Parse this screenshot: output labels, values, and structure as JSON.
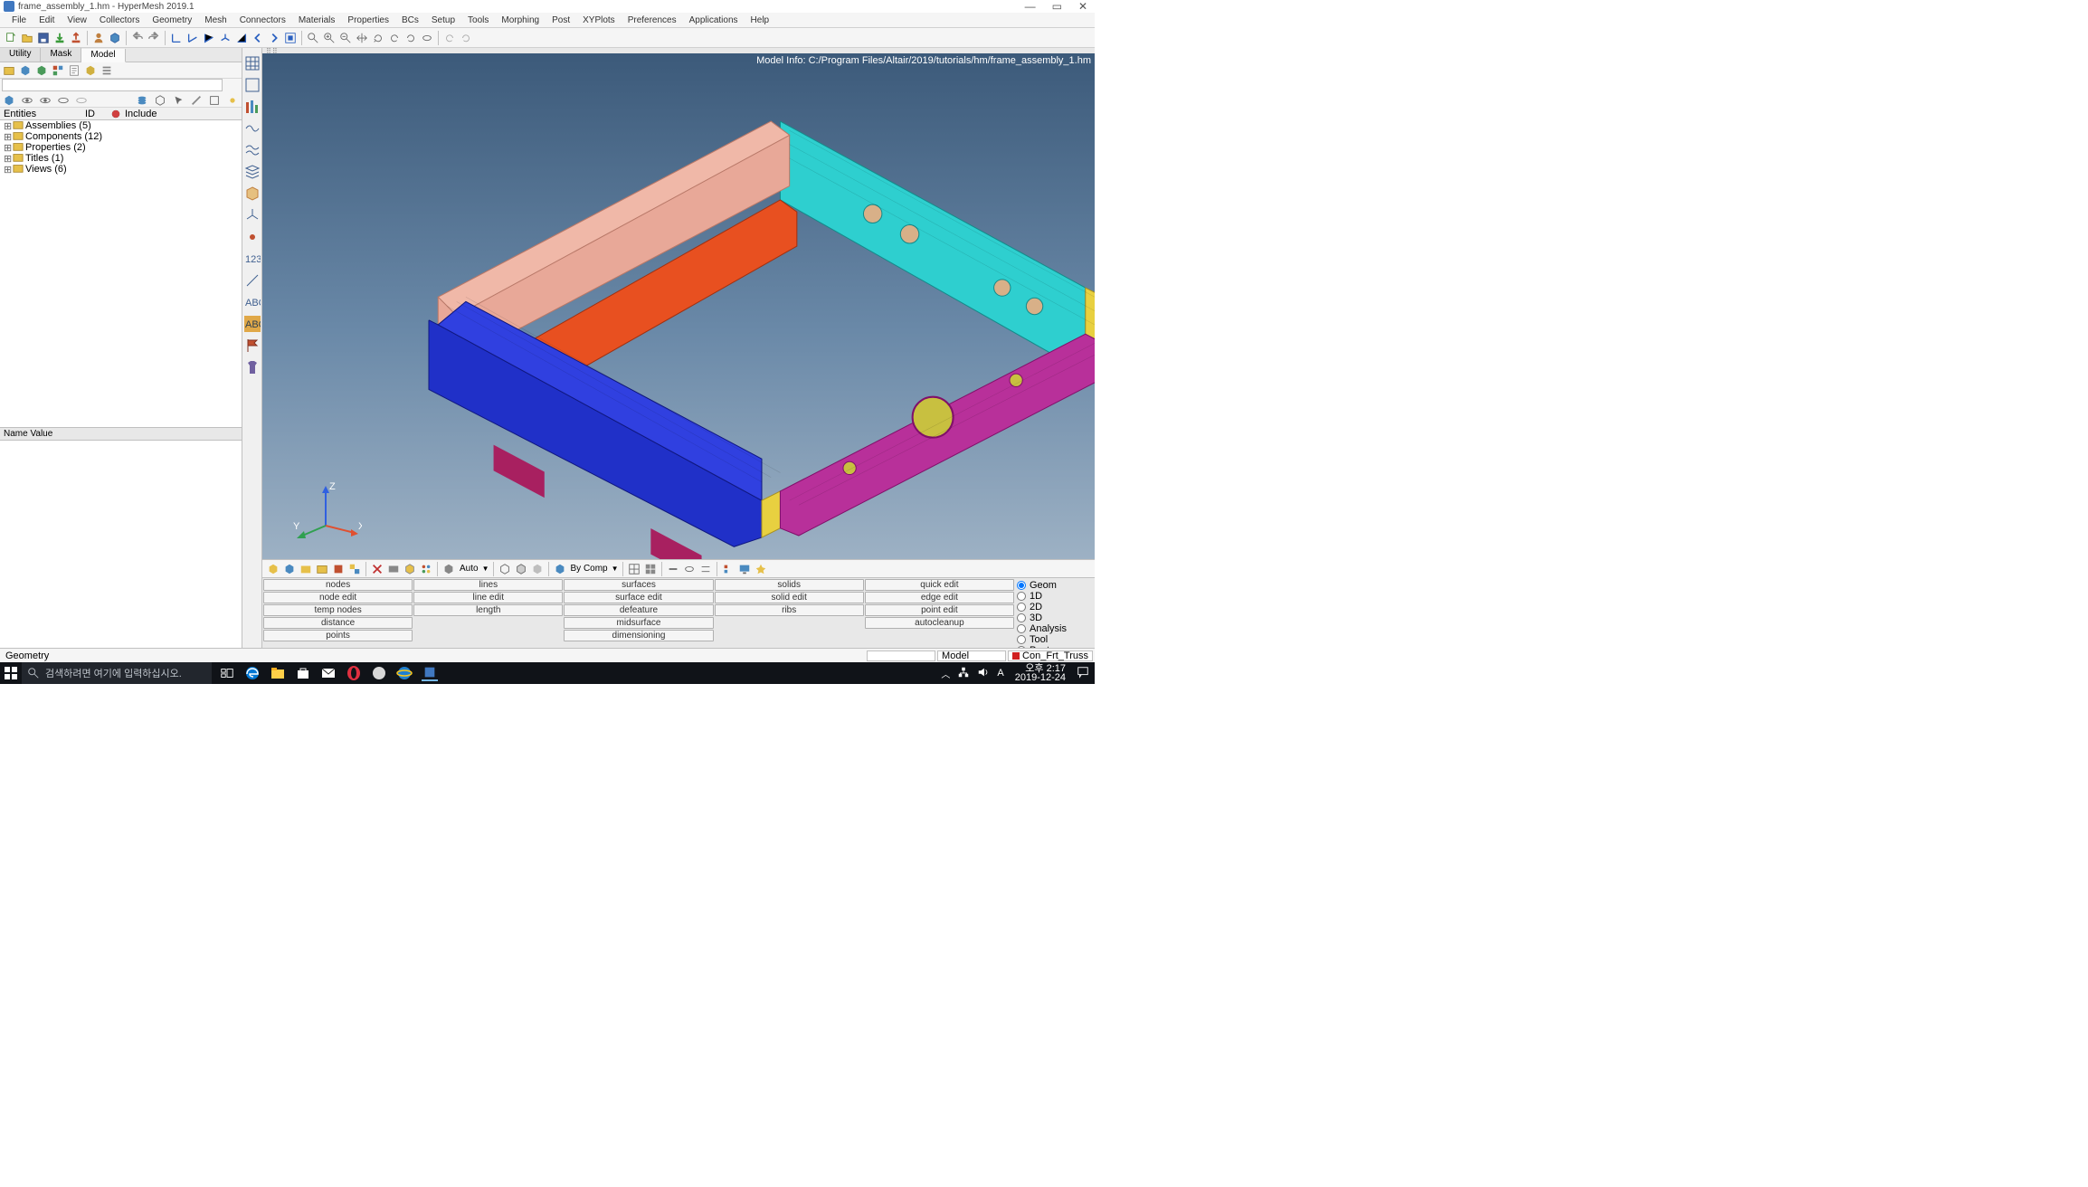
{
  "title": "frame_assembly_1.hm - HyperMesh 2019.1",
  "menus": [
    "File",
    "Edit",
    "View",
    "Collectors",
    "Geometry",
    "Mesh",
    "Connectors",
    "Materials",
    "Properties",
    "BCs",
    "Setup",
    "Tools",
    "Morphing",
    "Post",
    "XYPlots",
    "Preferences",
    "Applications",
    "Help"
  ],
  "left_tabs": [
    "Utility",
    "Mask",
    "Model"
  ],
  "tree_header": {
    "c1": "Entities",
    "c2": "ID",
    "c3": "Include"
  },
  "tree": [
    {
      "label": "Assemblies (5)"
    },
    {
      "label": "Components (12)"
    },
    {
      "label": "Properties (2)"
    },
    {
      "label": "Titles (1)"
    },
    {
      "label": "Views (6)"
    }
  ],
  "name_value_header": "Name Value",
  "model_info": "Model Info: C:/Program Files/Altair/2019/tutorials/hm/frame_assembly_1.hm",
  "axes": {
    "x": "X",
    "y": "Y",
    "z": "Z"
  },
  "disp_auto": "Auto",
  "disp_bycomp": "By Comp",
  "panel_buttons": {
    "r0": [
      "nodes",
      "lines",
      "surfaces",
      "solids",
      "quick edit"
    ],
    "r1": [
      "node edit",
      "line edit",
      "surface edit",
      "solid edit",
      "edge edit"
    ],
    "r2": [
      "temp nodes",
      "length",
      "defeature",
      "ribs",
      "point edit"
    ],
    "r3": [
      "distance",
      "",
      "midsurface",
      "",
      "autocleanup"
    ],
    "r4": [
      "points",
      "",
      "dimensioning",
      "",
      ""
    ]
  },
  "pages": [
    "Geom",
    "1D",
    "2D",
    "3D",
    "Analysis",
    "Tool",
    "Post"
  ],
  "status_left": "Geometry",
  "status_model": "Model",
  "status_comp": "Con_Frt_Truss",
  "task_search_placeholder": "검색하려면 여기에 입력하십시오.",
  "clock_time": "오후 2:17",
  "clock_date": "2019-12-24"
}
